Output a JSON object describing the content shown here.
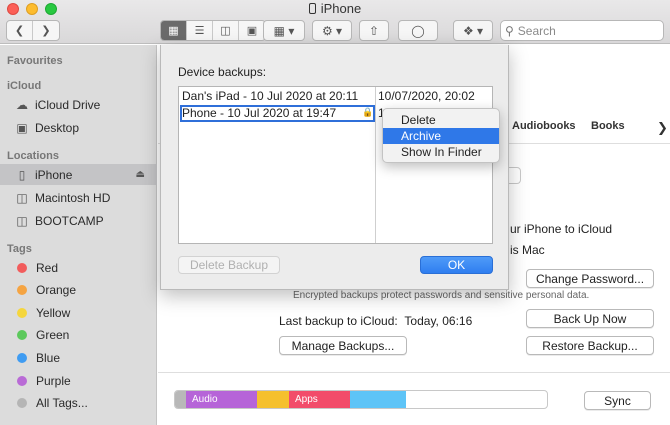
{
  "window": {
    "title": "iPhone"
  },
  "toolbar": {
    "search_placeholder": "Search"
  },
  "sidebar": {
    "favourites_header": "Favourites",
    "icloud_header": "iCloud",
    "icloud_items": [
      "iCloud Drive",
      "Desktop"
    ],
    "locations_header": "Locations",
    "location_items": [
      "iPhone",
      "Macintosh HD",
      "BOOTCAMP"
    ],
    "tags_header": "Tags",
    "tags": [
      {
        "label": "Red",
        "color": "#f25c5c"
      },
      {
        "label": "Orange",
        "color": "#f5a442"
      },
      {
        "label": "Yellow",
        "color": "#f5d63d"
      },
      {
        "label": "Green",
        "color": "#5cc95c"
      },
      {
        "label": "Blue",
        "color": "#3f9cf2"
      },
      {
        "label": "Purple",
        "color": "#b96bd6"
      },
      {
        "label": "All Tags...",
        "color": "#b5b5b5"
      }
    ]
  },
  "main": {
    "tab_audiobooks": "Audiobooks",
    "tab_books": "Books",
    "text_icloud_partial": "ur iPhone to iCloud",
    "text_mac_partial": "is Mac",
    "change_password": "Change Password...",
    "encrypted_note": "Encrypted backups protect passwords and sensitive personal data.",
    "last_backup_label": "Last backup to iCloud:",
    "last_backup_value": "Today, 06:16",
    "back_up_now": "Back Up Now",
    "manage_backups": "Manage Backups...",
    "restore_backup": "Restore Backup...",
    "sync": "Sync",
    "storage": [
      {
        "label": "",
        "color": "#b8b8b8",
        "fraction": 0.03
      },
      {
        "label": "Audio",
        "color": "#b664d8",
        "fraction": 0.19
      },
      {
        "label": "",
        "color": "#f5c02e",
        "fraction": 0.085
      },
      {
        "label": "Apps",
        "color": "#f24c6a",
        "fraction": 0.165
      },
      {
        "label": "",
        "color": "#5ec4f7",
        "fraction": 0.15
      }
    ]
  },
  "dialog": {
    "title": "Device backups:",
    "rows": [
      {
        "name": "Dan's iPad - 10 Jul 2020 at 20:11",
        "date": "10/07/2020, 20:02"
      },
      {
        "name": "Phone - 10 Jul 2020 at 19:47",
        "date": "1("
      }
    ],
    "delete_backup": "Delete Backup",
    "ok": "OK"
  },
  "context_menu": {
    "items": [
      "Delete",
      "Archive",
      "Show In Finder"
    ],
    "highlighted": "Archive"
  }
}
